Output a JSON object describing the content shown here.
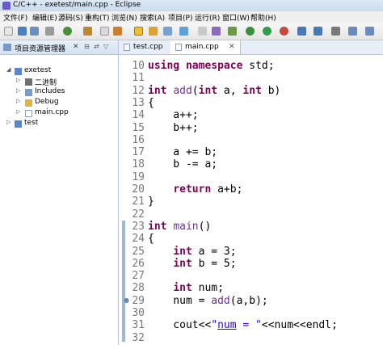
{
  "window": {
    "title": "C/C++ - exetest/main.cpp - Eclipse"
  },
  "menu": [
    "文件(F)",
    "编辑(E)",
    "源码(S)",
    "重构(T)",
    "浏览(N)",
    "搜索(A)",
    "项目(P)",
    "运行(R)",
    "窗口(W)",
    "帮助(H)"
  ],
  "sidebar": {
    "title": "项目资源管理器",
    "close": "✕",
    "tree": [
      {
        "label": "exetest",
        "icon": "project-folder-icon",
        "expanded": true
      },
      {
        "label": "二进制",
        "icon": "binaries-icon"
      },
      {
        "label": "Includes",
        "icon": "includes-icon"
      },
      {
        "label": "Debug",
        "icon": "folder-icon"
      },
      {
        "label": "main.cpp",
        "icon": "cpp-file-icon"
      },
      {
        "label": "test",
        "icon": "project-folder-icon",
        "expanded": false
      }
    ]
  },
  "editor": {
    "tabs": [
      {
        "label": "test.cpp",
        "active": false
      },
      {
        "label": "main.cpp",
        "active": true
      }
    ],
    "lines": [
      {
        "n": "10",
        "text": "using namespace std;"
      },
      {
        "n": "11",
        "text": ""
      },
      {
        "n": "12",
        "text": "int add(int a, int b)"
      },
      {
        "n": "13",
        "text": "{"
      },
      {
        "n": "14",
        "text": "    a++;"
      },
      {
        "n": "15",
        "text": "    b++;"
      },
      {
        "n": "16",
        "text": ""
      },
      {
        "n": "17",
        "text": "    a += b;"
      },
      {
        "n": "18",
        "text": "    b -= a;"
      },
      {
        "n": "19",
        "text": ""
      },
      {
        "n": "20",
        "text": "    return a+b;"
      },
      {
        "n": "21",
        "text": "}"
      },
      {
        "n": "22",
        "text": ""
      },
      {
        "n": "23",
        "text": "int main()"
      },
      {
        "n": "24",
        "text": "{"
      },
      {
        "n": "25",
        "text": "    int a = 3;"
      },
      {
        "n": "26",
        "text": "    int b = 5;"
      },
      {
        "n": "27",
        "text": ""
      },
      {
        "n": "28",
        "text": "    int num;"
      },
      {
        "n": "29",
        "text": "    num = add(a,b);"
      },
      {
        "n": "30",
        "text": ""
      },
      {
        "n": "31",
        "text": "    cout<<\"num = \"<<num<<endl;"
      },
      {
        "n": "32",
        "text": ""
      }
    ]
  },
  "colors": {
    "keyword": "#7f0055",
    "function": "#7030a0",
    "string": "#2a00ff",
    "line_number": "#787878"
  }
}
